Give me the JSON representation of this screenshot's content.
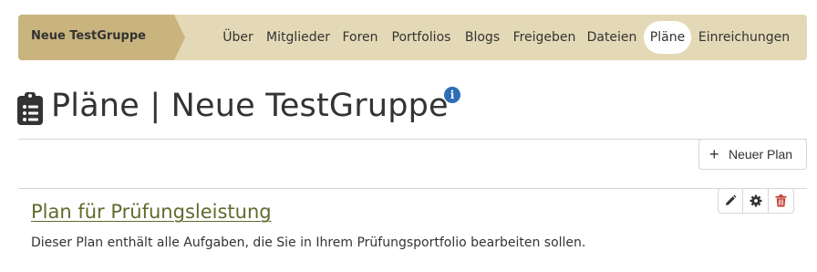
{
  "group_nav": {
    "group_name": "Neue TestGruppe",
    "tabs": [
      {
        "label": "Über",
        "active": false
      },
      {
        "label": "Mitglieder",
        "active": false
      },
      {
        "label": "Foren",
        "active": false
      },
      {
        "label": "Portfolios",
        "active": false
      },
      {
        "label": "Blogs",
        "active": false
      },
      {
        "label": "Freigeben",
        "active": false
      },
      {
        "label": "Dateien",
        "active": false
      },
      {
        "label": "Pläne",
        "active": true
      },
      {
        "label": "Einreichungen",
        "active": false
      }
    ]
  },
  "header": {
    "title": "Pläne | Neue TestGruppe",
    "title_icon": "clipboard-list-icon",
    "info_icon": "info-icon"
  },
  "toolbar": {
    "new_plan_label": "Neuer Plan",
    "new_plan_icon": "plus-icon"
  },
  "plans": [
    {
      "title": "Plan für Prüfungsleistung",
      "description": "Dieser Plan enthält alle Aufgaben, die Sie in Ihrem Prüfungsportfolio bearbeiten sollen.",
      "actions": [
        {
          "icon": "pencil-icon",
          "color": "#333333"
        },
        {
          "icon": "gear-icon",
          "color": "#333333"
        },
        {
          "icon": "trash-icon",
          "color": "#c0392b"
        }
      ]
    }
  ],
  "colors": {
    "nav_background": "#e4d9b6",
    "group_name_background": "#c9b47e",
    "link": "#5f6a2b",
    "info": "#2f6db5",
    "danger": "#c0392b"
  }
}
